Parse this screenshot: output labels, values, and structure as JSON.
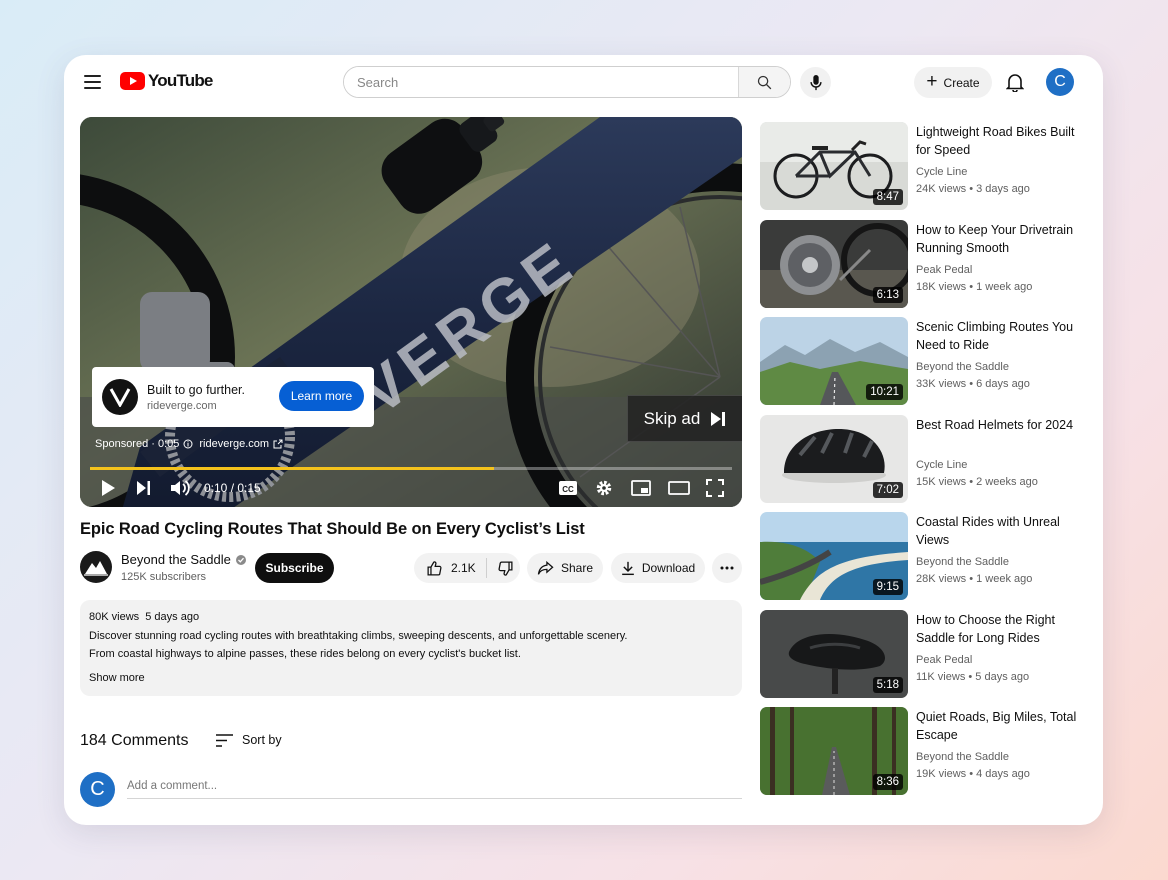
{
  "header": {
    "logo_text": "YouTube",
    "search_placeholder": "Search",
    "create_label": "Create",
    "avatar_initial": "C"
  },
  "player": {
    "ad_title": "Built to go further.",
    "ad_domain": "rideverge.com",
    "learn_more": "Learn more",
    "sponsored": "Sponsored · 0:05",
    "sponsored_link": "rideverge.com",
    "skip_label": "Skip ad",
    "time": "0:10 / 0:15",
    "progress": 0.63,
    "frame_text": "VERGE"
  },
  "video": {
    "title": "Epic Road Cycling Routes That Should Be on Every Cyclist’s List",
    "channel": "Beyond the Saddle",
    "subscribers": "125K subscribers",
    "subscribe": "Subscribe",
    "likes": "2.1K",
    "share": "Share",
    "download": "Download"
  },
  "description": {
    "meta": "80K views  5 days ago",
    "line1": "Discover stunning road cycling routes with breathtaking climbs, sweeping descents, and unforgettable scenery.",
    "line2": "From coastal highways to alpine passes, these rides belong on every cyclist's bucket list.",
    "show_more": "Show more"
  },
  "comments": {
    "count": "184 Comments",
    "sort_by": "Sort by",
    "avatar_initial": "C",
    "placeholder": "Add a comment..."
  },
  "recommendations": [
    {
      "title": "Lightweight Road Bikes Built for Speed",
      "channel": "Cycle Line",
      "meta": "24K views • 3 days ago",
      "duration": "8:47",
      "thumb": "bike"
    },
    {
      "title": "How to Keep Your Drivetrain Running Smooth",
      "channel": "Peak Pedal",
      "meta": "18K views • 1 week ago",
      "duration": "6:13",
      "thumb": "drivetrain"
    },
    {
      "title": "Scenic Climbing Routes You Need to Ride",
      "channel": "Beyond the Saddle",
      "meta": "33K views • 6 days ago",
      "duration": "10:21",
      "thumb": "mountains"
    },
    {
      "title": "Best Road Helmets for 2024",
      "channel": "Cycle Line",
      "meta": "15K views • 2 weeks ago",
      "duration": "7:02",
      "thumb": "helmet"
    },
    {
      "title": "Coastal Rides with Unreal Views",
      "channel": "Beyond the Saddle",
      "meta": "28K views • 1 week ago",
      "duration": "9:15",
      "thumb": "coast"
    },
    {
      "title": "How to Choose the Right Saddle for Long Rides",
      "channel": "Peak Pedal",
      "meta": "11K views • 5 days ago",
      "duration": "5:18",
      "thumb": "saddle"
    },
    {
      "title": "Quiet Roads, Big Miles, Total Escape",
      "channel": "Beyond the Saddle",
      "meta": "19K views • 4 days ago",
      "duration": "8:36",
      "thumb": "forest"
    }
  ],
  "colors": {
    "brand_red": "#ff0000",
    "accent_blue": "#065fd4",
    "ad_progress": "#f4c21c"
  }
}
